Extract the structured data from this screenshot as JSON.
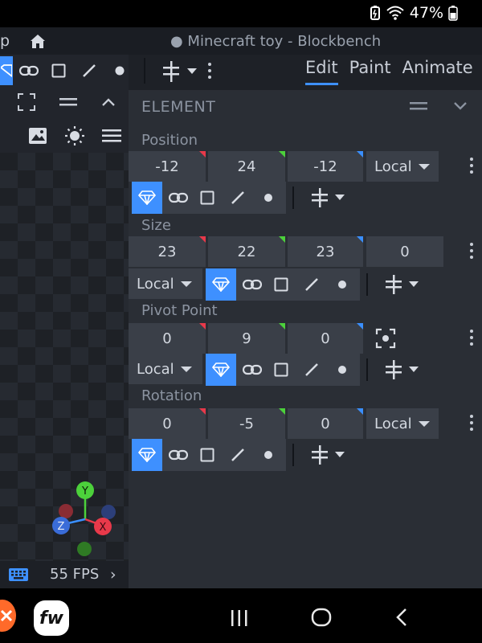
{
  "status_bar": {
    "battery": "47%"
  },
  "title_bar": {
    "partial_menu": "p",
    "window_title": "● Minecraft toy - Blockbench"
  },
  "mode_tabs": [
    {
      "label": "Edit"
    },
    {
      "label": "Paint"
    },
    {
      "label": "Animate"
    }
  ],
  "viewport": {
    "fps": "55 FPS"
  },
  "panel": {
    "title": "ELEMENT",
    "position": {
      "label": "Position",
      "x": "-12",
      "y": "24",
      "z": "-12",
      "space": "Local"
    },
    "size": {
      "label": "Size",
      "x": "23",
      "y": "22",
      "z": "23",
      "inflate": "0",
      "space": "Local"
    },
    "pivot": {
      "label": "Pivot Point",
      "x": "0",
      "y": "9",
      "z": "0",
      "space": "Local"
    },
    "rotation": {
      "label": "Rotation",
      "x": "0",
      "y": "-5",
      "z": "0",
      "space": "Local"
    }
  },
  "gizmo": {
    "y": "Y",
    "x": "X",
    "z": "Z"
  },
  "dock": {
    "fw_label": "fw"
  },
  "colors": {
    "accent": "#3e90ff",
    "axis_x": "#e8394a",
    "axis_y": "#4cd13b",
    "axis_z": "#3a8fff"
  }
}
